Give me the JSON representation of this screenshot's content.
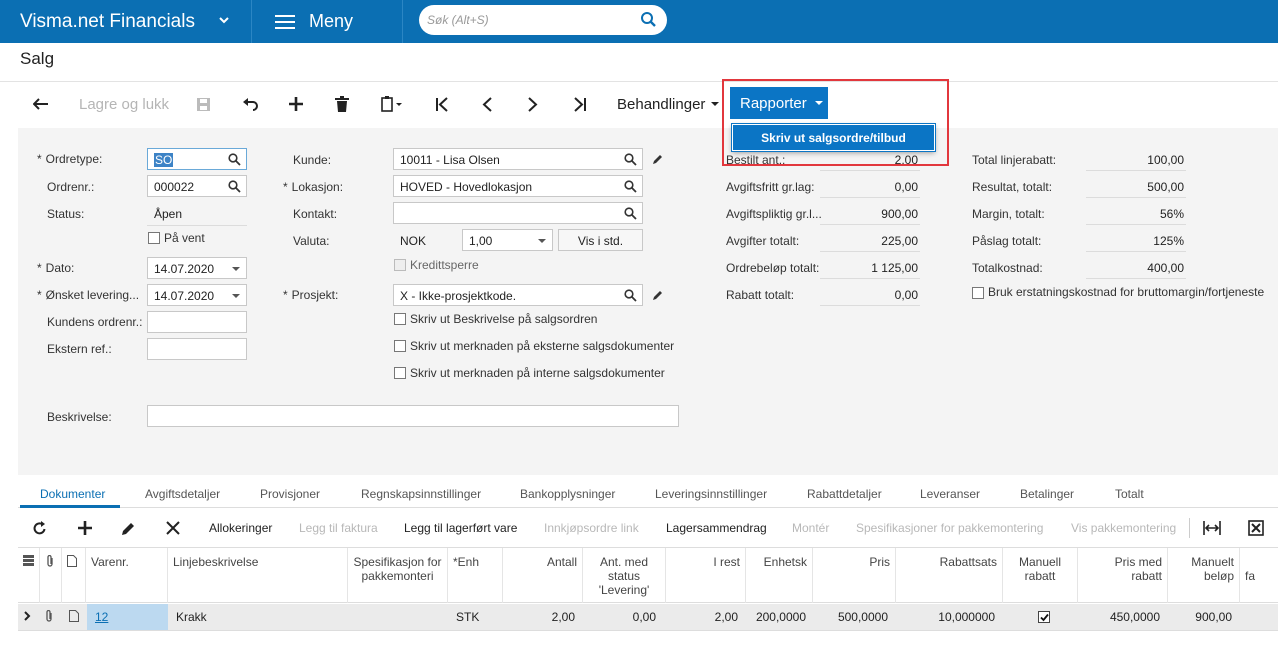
{
  "app": {
    "title": "Visma.net Financials",
    "menu_label": "Meny",
    "search_placeholder": "Søk (Alt+S)"
  },
  "page": {
    "title": "Salg"
  },
  "toolbar": {
    "save_close": "Lagre og lukk",
    "behandlinger": "Behandlinger",
    "rapporter": "Rapporter",
    "rapporter_item": "Skriv ut salgsordre/tilbud"
  },
  "form": {
    "ordretype_label": "Ordretype:",
    "ordretype": "SO",
    "ordrenr_label": "Ordrenr.:",
    "ordrenr": "000022",
    "status_label": "Status:",
    "status": "Åpen",
    "pavent_label": "På vent",
    "dato_label": "Dato:",
    "dato": "14.07.2020",
    "onsket_label": "Ønsket levering...",
    "onsket": "14.07.2020",
    "kundens_label": "Kundens ordrenr.:",
    "ekstern_label": "Ekstern ref.:",
    "beskrivelse_label": "Beskrivelse:",
    "kunde_label": "Kunde:",
    "kunde": "10011 - Lisa Olsen",
    "lokasjon_label": "Lokasjon:",
    "lokasjon": "HOVED - Hovedlokasjon",
    "kontakt_label": "Kontakt:",
    "valuta_label": "Valuta:",
    "valuta": "NOK",
    "kurs": "1,00",
    "vis_std": "Vis i std.",
    "kredittsperre_label": "Kredittsperre",
    "prosjekt_label": "Prosjekt:",
    "prosjekt": "X - Ikke-prosjektkode.",
    "cb1": "Skriv ut Beskrivelse på salgsordren",
    "cb2": "Skriv ut merknaden på eksterne salgsdokumenter",
    "cb3": "Skriv ut merknaden på interne salgsdokumenter"
  },
  "totals_mid": [
    {
      "label": "Bestilt ant.:",
      "value": "2,00"
    },
    {
      "label": "Avgiftsfritt gr.lag:",
      "value": "0,00"
    },
    {
      "label": "Avgiftspliktig gr.l...",
      "value": "900,00"
    },
    {
      "label": "Avgifter totalt:",
      "value": "225,00"
    },
    {
      "label": "Ordrebeløp totalt:",
      "value": "1 125,00"
    },
    {
      "label": "Rabatt totalt:",
      "value": "0,00"
    }
  ],
  "totals_right": [
    {
      "label": "Total linjerabatt:",
      "value": "100,00"
    },
    {
      "label": "Resultat, totalt:",
      "value": "500,00"
    },
    {
      "label": "Margin, totalt:",
      "value": "56%"
    },
    {
      "label": "Påslag totalt:",
      "value": "125%"
    },
    {
      "label": "Totalkostnad:",
      "value": "400,00"
    }
  ],
  "bruk_label": "Bruk erstatningskostnad for bruttomargin/fortjeneste",
  "tabs": [
    "Dokumenter",
    "Avgiftsdetaljer",
    "Provisjoner",
    "Regnskapsinnstillinger",
    "Bankopplysninger",
    "Leveringsinnstillinger",
    "Rabattdetaljer",
    "Leveranser",
    "Betalinger",
    "Totalt"
  ],
  "grid_toolbar": {
    "allokeringer": "Allokeringer",
    "legg_faktura": "Legg til faktura",
    "legg_lager": "Legg til lagerført vare",
    "innkjop": "Innkjøpsordre link",
    "lagersammendrag": "Lagersammendrag",
    "monter": "Montér",
    "spesifikasjoner": "Spesifikasjoner for pakkemontering",
    "vis_pakke": "Vis pakkemontering"
  },
  "grid": {
    "headers": [
      "Varenr.",
      "Linjebeskrivelse",
      "Spesifikasjon for pakkemonteri",
      "*Enh",
      "Antall",
      "Ant. med status 'Levering'",
      "I rest",
      "Enhetsk",
      "Pris",
      "Rabattsats",
      "Manuell rabatt",
      "Pris med rabatt",
      "Manuelt beløp",
      "fa"
    ],
    "row": {
      "varenr": "12",
      "beskrivelse": "Krakk",
      "enh": "STK",
      "antall": "2,00",
      "ant_levering": "0,00",
      "i_rest": "2,00",
      "enhetsk": "200,0000",
      "pris": "500,0000",
      "rabattsats": "10,000000",
      "pris_rabatt": "450,0000",
      "manuelt_belop": "900,00"
    }
  }
}
